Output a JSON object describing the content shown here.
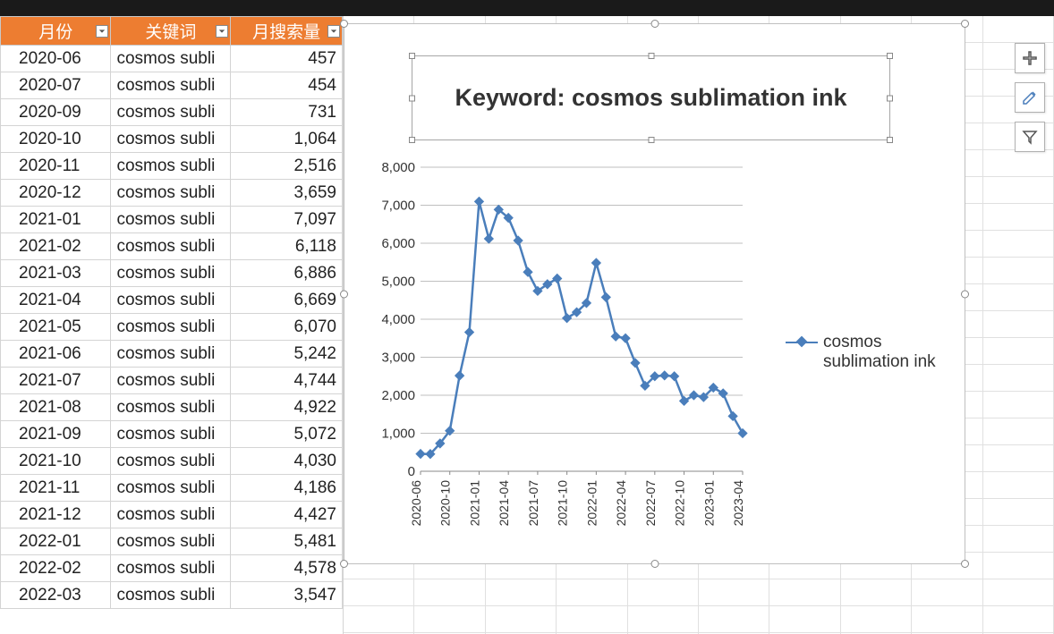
{
  "headers": {
    "month": "月份",
    "keyword": "关键词",
    "volume": "月搜索量"
  },
  "keyword_truncated": "cosmos subli",
  "rows": [
    {
      "month": "2020-06",
      "val": "457"
    },
    {
      "month": "2020-07",
      "val": "454"
    },
    {
      "month": "2020-09",
      "val": "731"
    },
    {
      "month": "2020-10",
      "val": "1,064"
    },
    {
      "month": "2020-11",
      "val": "2,516"
    },
    {
      "month": "2020-12",
      "val": "3,659"
    },
    {
      "month": "2021-01",
      "val": "7,097"
    },
    {
      "month": "2021-02",
      "val": "6,118"
    },
    {
      "month": "2021-03",
      "val": "6,886"
    },
    {
      "month": "2021-04",
      "val": "6,669"
    },
    {
      "month": "2021-05",
      "val": "6,070"
    },
    {
      "month": "2021-06",
      "val": "5,242"
    },
    {
      "month": "2021-07",
      "val": "4,744"
    },
    {
      "month": "2021-08",
      "val": "4,922"
    },
    {
      "month": "2021-09",
      "val": "5,072"
    },
    {
      "month": "2021-10",
      "val": "4,030"
    },
    {
      "month": "2021-11",
      "val": "4,186"
    },
    {
      "month": "2021-12",
      "val": "4,427"
    },
    {
      "month": "2022-01",
      "val": "5,481"
    },
    {
      "month": "2022-02",
      "val": "4,578"
    },
    {
      "month": "2022-03",
      "val": "3,547"
    }
  ],
  "chart_title": "Keyword: cosmos sublimation ink",
  "legend_label": "cosmos sublimation ink",
  "y_ticks": [
    "0",
    "1,000",
    "2,000",
    "3,000",
    "4,000",
    "5,000",
    "6,000",
    "7,000",
    "8,000"
  ],
  "x_tick_labels": [
    "2020-06",
    "2020-10",
    "2021-01",
    "2021-04",
    "2021-07",
    "2021-10",
    "2022-01",
    "2022-04",
    "2022-07",
    "2022-10",
    "2023-01",
    "2023-04"
  ],
  "chart_data": {
    "type": "line",
    "title": "Keyword: cosmos sublimation ink",
    "xlabel": "",
    "ylabel": "",
    "ylim": [
      0,
      8000
    ],
    "series": [
      {
        "name": "cosmos sublimation ink",
        "x": [
          "2020-06",
          "2020-07",
          "2020-09",
          "2020-10",
          "2020-11",
          "2020-12",
          "2021-01",
          "2021-02",
          "2021-03",
          "2021-04",
          "2021-05",
          "2021-06",
          "2021-07",
          "2021-08",
          "2021-09",
          "2021-10",
          "2021-11",
          "2021-12",
          "2022-01",
          "2022-02",
          "2022-03",
          "2022-04",
          "2022-05",
          "2022-06",
          "2022-07",
          "2022-08",
          "2022-09",
          "2022-10",
          "2022-11",
          "2022-12",
          "2023-01",
          "2023-02",
          "2023-03",
          "2023-04"
        ],
        "values": [
          457,
          454,
          731,
          1064,
          2516,
          3659,
          7097,
          6118,
          6886,
          6669,
          6070,
          5242,
          4744,
          4922,
          5072,
          4030,
          4186,
          4427,
          5481,
          4578,
          3547,
          3500,
          2850,
          2250,
          2500,
          2520,
          2500,
          1850,
          2000,
          1950,
          2200,
          2050,
          1450,
          1000
        ]
      }
    ],
    "x_tick_labels": [
      "2020-06",
      "2020-10",
      "2021-01",
      "2021-04",
      "2021-07",
      "2021-10",
      "2022-01",
      "2022-04",
      "2022-07",
      "2022-10",
      "2023-01",
      "2023-04"
    ]
  }
}
